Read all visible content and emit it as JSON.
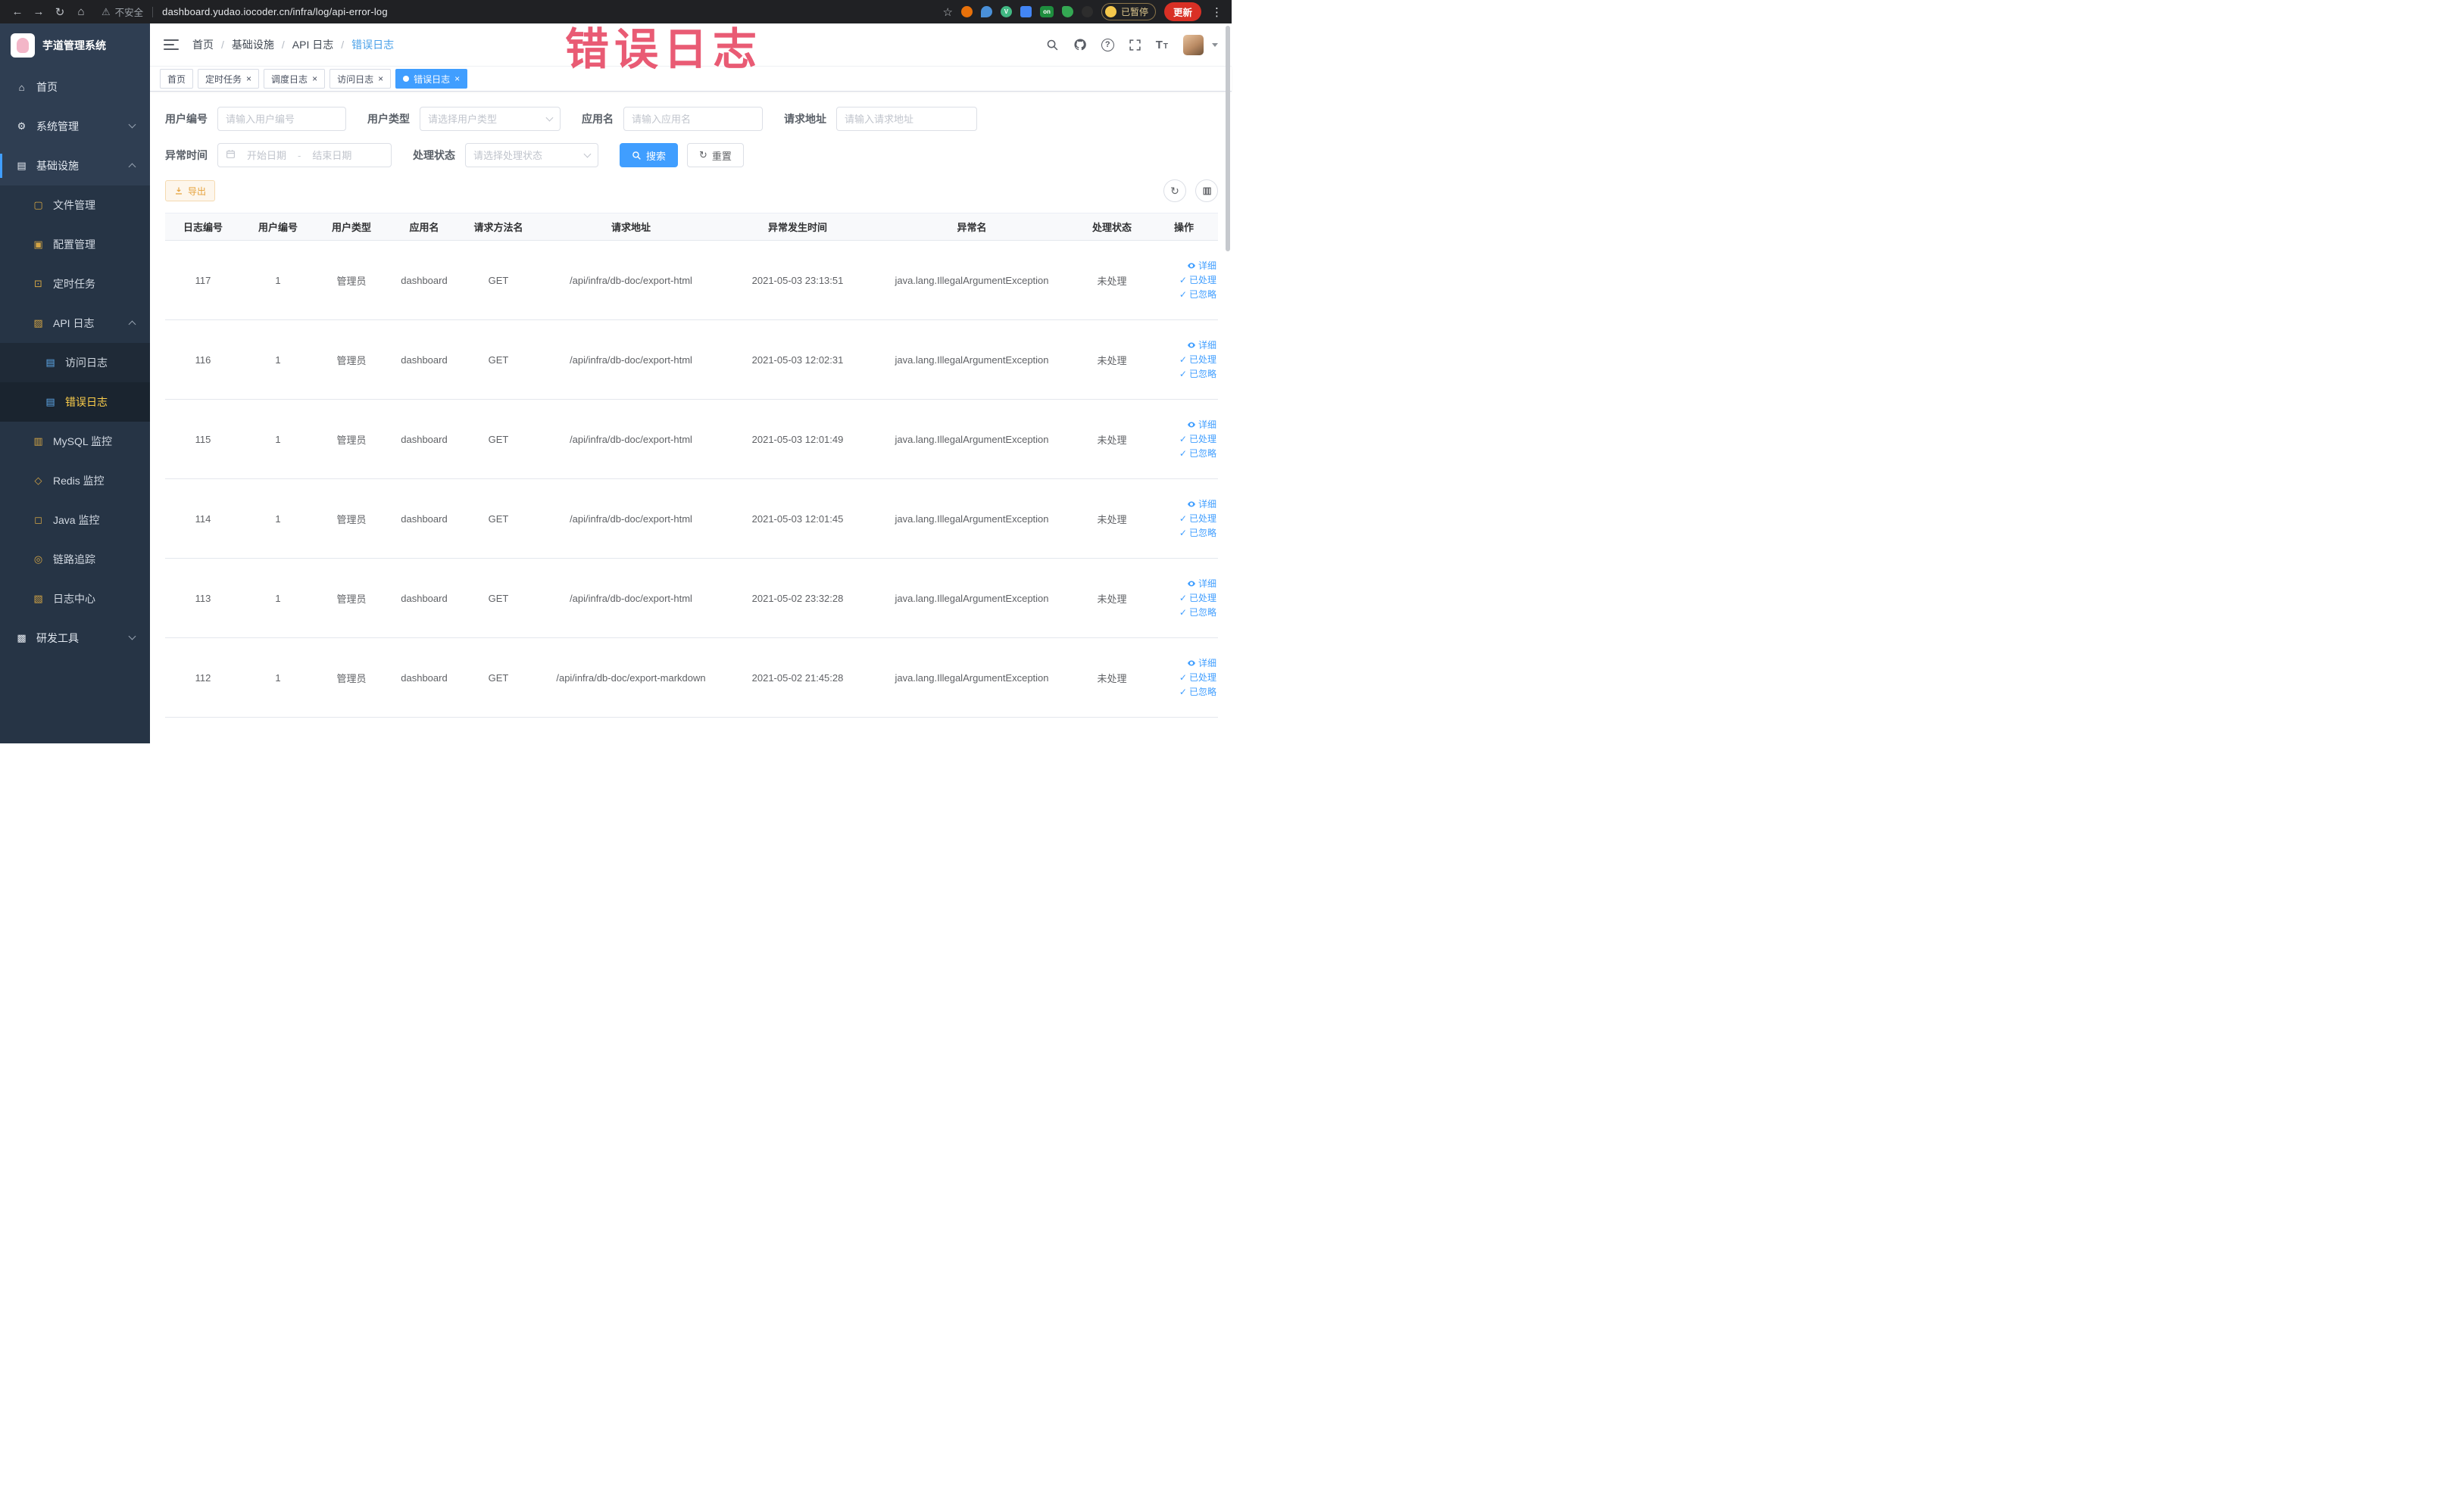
{
  "icons": {
    "back": "←",
    "forward": "→",
    "reload": "↻",
    "home": "⌂",
    "star": "☆",
    "kebab": "⋮",
    "warning": "⚠",
    "close": "×",
    "check": "✓",
    "question": "?",
    "refresh": "↻",
    "ext_on_badge": "on",
    "font_size": "T"
  },
  "browser": {
    "security_label": "不安全",
    "url": "dashboard.yudao.iocoder.cn/infra/log/api-error-log",
    "paused_label": "已暂停",
    "update_label": "更新"
  },
  "overlay_title": "错误日志",
  "sidebar": {
    "app_title": "芋道管理系统",
    "icons": {
      "home": "⌂",
      "system": "⚙",
      "infra": "▤",
      "file": "▢",
      "config": "▣",
      "task": "⊡",
      "api": "▨",
      "access": "▤",
      "error": "▤",
      "mysql": "▥",
      "redis": "◇",
      "java": "◻",
      "trace": "◎",
      "logcenter": "▧",
      "tools": "▩"
    },
    "items": [
      {
        "label": "首页"
      },
      {
        "label": "系统管理"
      },
      {
        "label": "基础设施"
      },
      {
        "label": "文件管理"
      },
      {
        "label": "配置管理"
      },
      {
        "label": "定时任务"
      },
      {
        "label": "API 日志"
      },
      {
        "label": "访问日志"
      },
      {
        "label": "错误日志"
      },
      {
        "label": "MySQL 监控"
      },
      {
        "label": "Redis 监控"
      },
      {
        "label": "Java 监控"
      },
      {
        "label": "链路追踪"
      },
      {
        "label": "日志中心"
      },
      {
        "label": "研发工具"
      }
    ]
  },
  "breadcrumb": {
    "separator": "/",
    "items": [
      "首页",
      "基础设施",
      "API 日志",
      "错误日志"
    ]
  },
  "tabs": [
    {
      "label": "首页"
    },
    {
      "label": "定时任务"
    },
    {
      "label": "调度日志"
    },
    {
      "label": "访问日志"
    },
    {
      "label": "错误日志"
    }
  ],
  "filters": {
    "user_id_label": "用户编号",
    "user_id_placeholder": "请输入用户编号",
    "user_type_label": "用户类型",
    "user_type_placeholder": "请选择用户类型",
    "app_name_label": "应用名",
    "app_name_placeholder": "请输入应用名",
    "request_url_label": "请求地址",
    "request_url_placeholder": "请输入请求地址",
    "exception_time_label": "异常时间",
    "date_start_placeholder": "开始日期",
    "date_separator": "-",
    "date_end_placeholder": "结束日期",
    "process_status_label": "处理状态",
    "process_status_placeholder": "请选择处理状态",
    "search_label": "搜索",
    "reset_label": "重置"
  },
  "toolbar": {
    "export_label": "导出"
  },
  "table": {
    "columns": [
      "日志编号",
      "用户编号",
      "用户类型",
      "应用名",
      "请求方法名",
      "请求地址",
      "异常发生时间",
      "异常名",
      "处理状态",
      "操作"
    ],
    "actions": [
      "详细",
      "已处理",
      "已忽略"
    ],
    "rows": [
      {
        "id": "117",
        "user_id": "1",
        "user_type": "管理员",
        "app": "dashboard",
        "method": "GET",
        "url": "/api/infra/db-doc/export-html",
        "time": "2021-05-03 23:13:51",
        "exception": "java.lang.IllegalArgumentException",
        "status": "未处理"
      },
      {
        "id": "116",
        "user_id": "1",
        "user_type": "管理员",
        "app": "dashboard",
        "method": "GET",
        "url": "/api/infra/db-doc/export-html",
        "time": "2021-05-03 12:02:31",
        "exception": "java.lang.IllegalArgumentException",
        "status": "未处理"
      },
      {
        "id": "115",
        "user_id": "1",
        "user_type": "管理员",
        "app": "dashboard",
        "method": "GET",
        "url": "/api/infra/db-doc/export-html",
        "time": "2021-05-03 12:01:49",
        "exception": "java.lang.IllegalArgumentException",
        "status": "未处理"
      },
      {
        "id": "114",
        "user_id": "1",
        "user_type": "管理员",
        "app": "dashboard",
        "method": "GET",
        "url": "/api/infra/db-doc/export-html",
        "time": "2021-05-03 12:01:45",
        "exception": "java.lang.IllegalArgumentException",
        "status": "未处理"
      },
      {
        "id": "113",
        "user_id": "1",
        "user_type": "管理员",
        "app": "dashboard",
        "method": "GET",
        "url": "/api/infra/db-doc/export-html",
        "time": "2021-05-02 23:32:28",
        "exception": "java.lang.IllegalArgumentException",
        "status": "未处理"
      },
      {
        "id": "112",
        "user_id": "1",
        "user_type": "管理员",
        "app": "dashboard",
        "method": "GET",
        "url": "/api/infra/db-doc/export-markdown",
        "time": "2021-05-02 21:45:28",
        "exception": "java.lang.IllegalArgumentException",
        "status": "未处理"
      }
    ]
  },
  "colors": {
    "accent": "#409EFF",
    "sidebar_bg": "#263445",
    "active_menu": "#ffd04b",
    "overlay_red": "#e64561",
    "warning": "#e6a23c"
  }
}
